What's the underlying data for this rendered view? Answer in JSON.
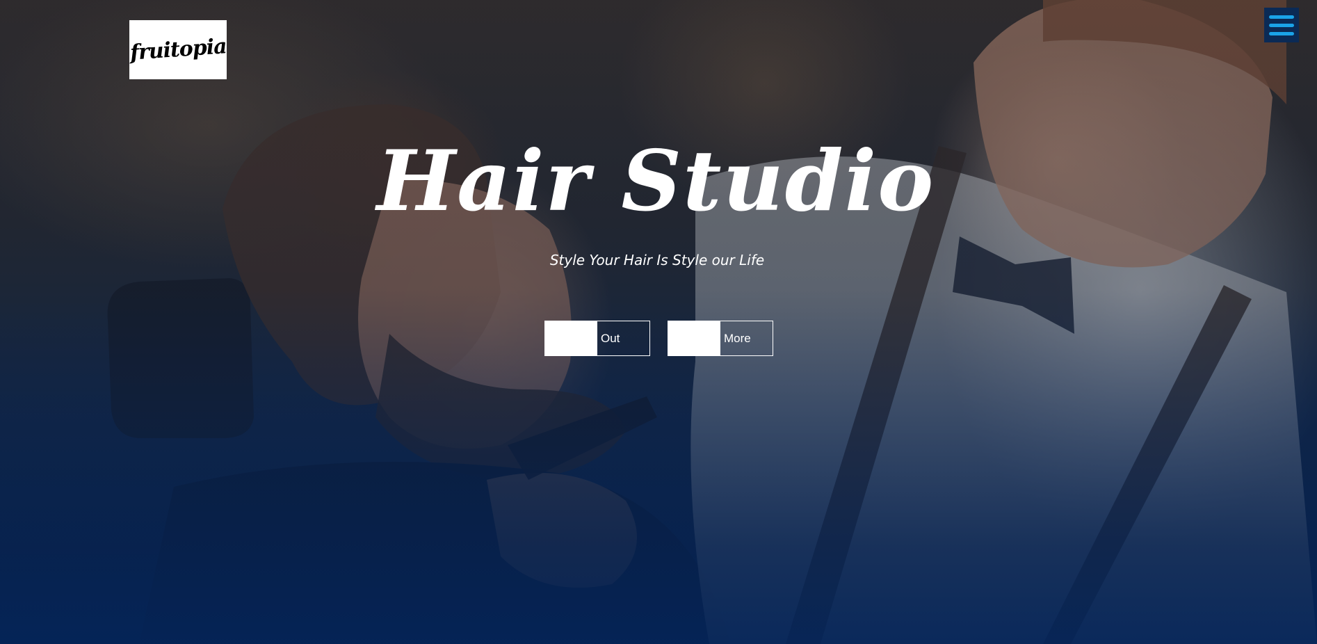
{
  "header": {
    "logo_text": "fruitopia",
    "menu_icon": "hamburger-menu-icon"
  },
  "hero": {
    "title": "Hair Studio",
    "subtitle": "Style Your Hair Is Style our Life",
    "buttons": [
      {
        "label": "Out"
      },
      {
        "label": "More"
      }
    ],
    "background_description_colors": {
      "overlay_bottom": "#042458",
      "accent": "#1aa3e8"
    }
  }
}
